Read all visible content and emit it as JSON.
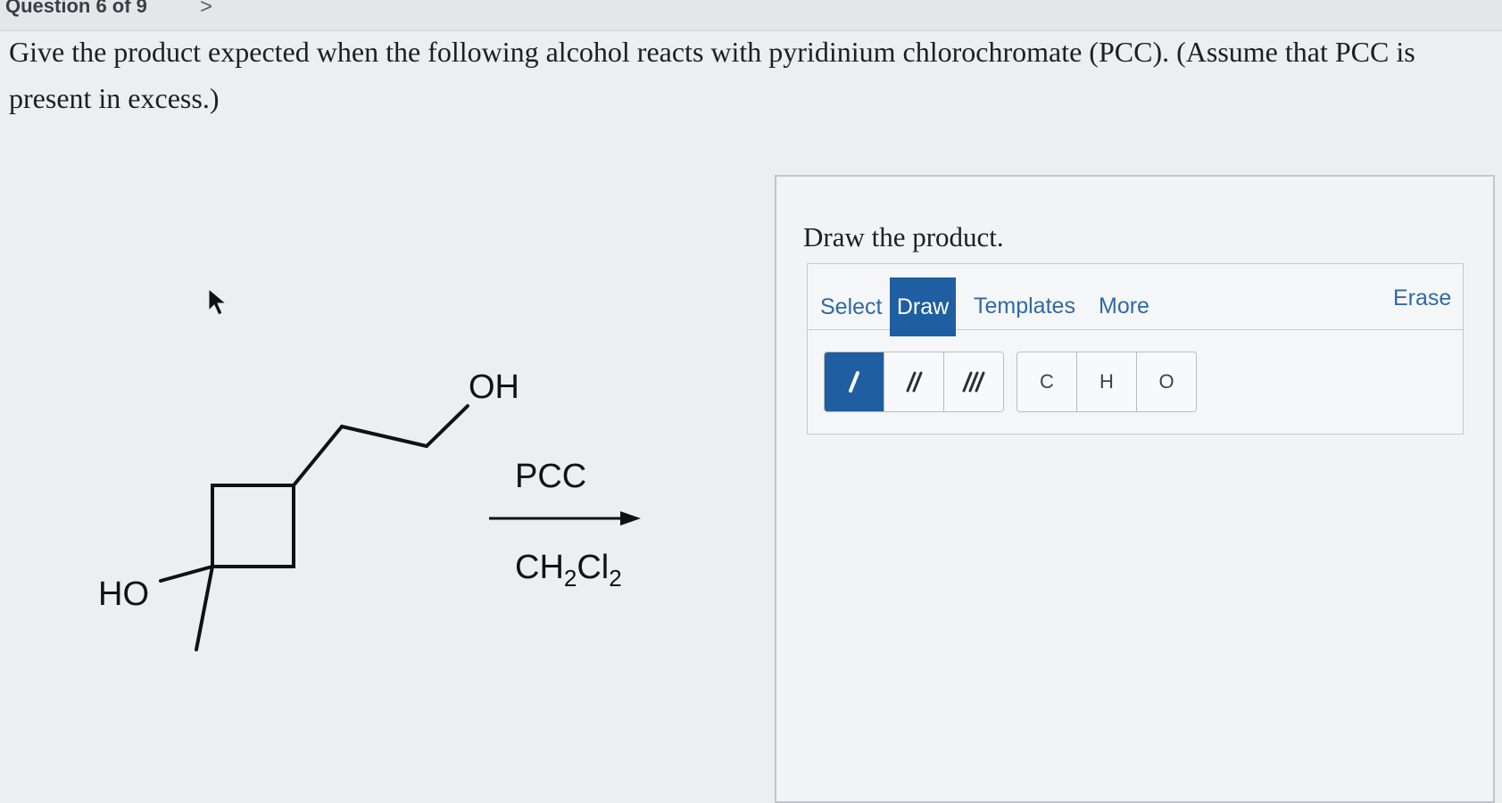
{
  "header": {
    "question_indicator": "Question 6 of 9",
    "next_symbol": ">"
  },
  "question": {
    "prompt_line1": "Give the product expected when the following alcohol reacts with pyridinium chlorochromate (PCC). (Assume that PCC is",
    "prompt_line2": "present in excess.)"
  },
  "reaction": {
    "oh_label": "OH",
    "ho_label": "HO",
    "reagent_top": "PCC",
    "reagent_bottom_parts": [
      "CH",
      "2",
      "Cl",
      "2"
    ]
  },
  "answer_panel": {
    "title": "Draw the product.",
    "tabs": [
      "Select",
      "Draw",
      "Templates",
      "More"
    ],
    "active_tab": "Draw",
    "erase_label": "Erase",
    "bond_tools": [
      "single-bond",
      "double-bond",
      "triple-bond"
    ],
    "active_bond_tool": "single-bond",
    "atom_buttons": [
      "C",
      "H",
      "O"
    ]
  },
  "colors": {
    "accent": "#1f5ea0",
    "link": "#2f6aa3"
  }
}
